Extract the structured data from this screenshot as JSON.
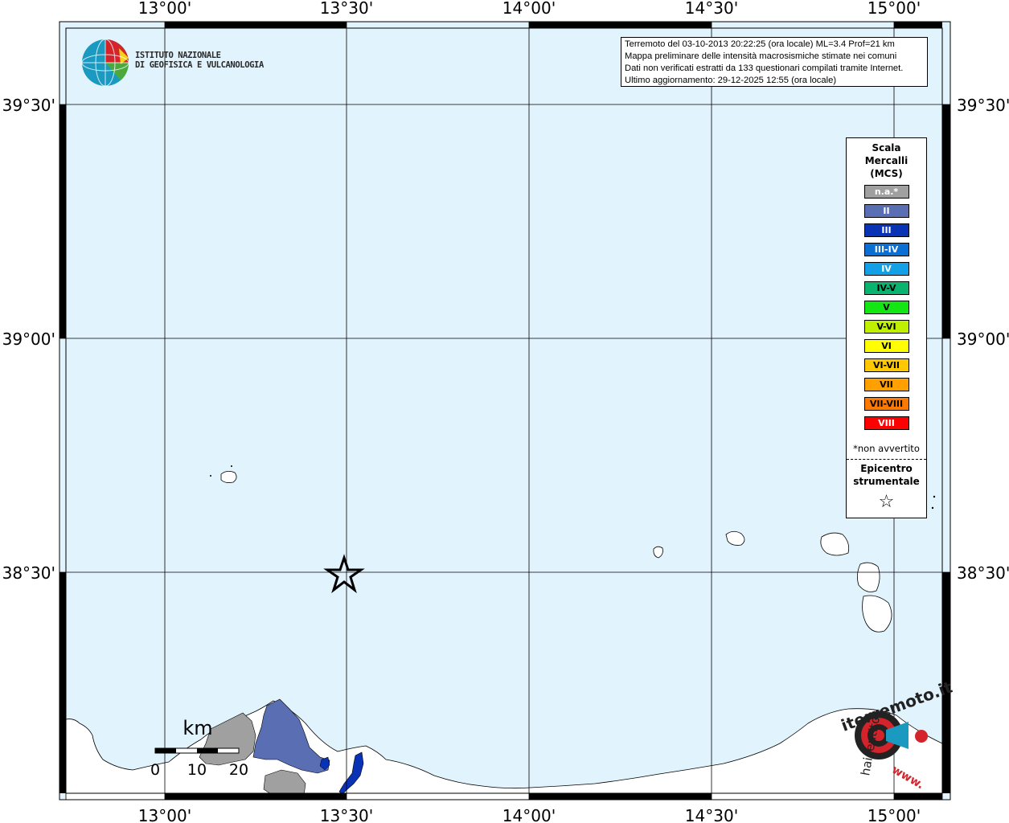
{
  "info": {
    "line1": "Terremoto del 03-10-2013 20:22:25 (ora locale) ML=3.4 Prof=21 km",
    "line2": "Mappa preliminare delle intensità macrosismiche stimate nei comuni",
    "line3": "Dati non verificati estratti da 133 questionari compilati tramite Internet.",
    "line4": "Ultimo aggiornamento: 29-12-2025 12:55 (ora locale)"
  },
  "logo": {
    "line1": "ISTITUTO NAZIONALE",
    "line2": "DI GEOFISICA E VULCANOLOGIA"
  },
  "axes": {
    "lon_labels": [
      "13°00'",
      "13°30'",
      "14°00'",
      "14°30'",
      "15°00'"
    ],
    "lat_labels": [
      "39°30'",
      "39°00'",
      "38°30'"
    ]
  },
  "scale_bar": {
    "unit": "km",
    "labels": [
      "0",
      "10",
      "20"
    ]
  },
  "legend": {
    "title_line1": "Scala",
    "title_line2": "Mercalli",
    "title_line3": "(MCS)",
    "items": [
      {
        "label": "n.a.*",
        "color": "#a0a0a0",
        "text_color": "#ffffff"
      },
      {
        "label": "II",
        "color": "#5a6eb4",
        "text_color": "#ffffff"
      },
      {
        "label": "III",
        "color": "#0a32b4",
        "text_color": "#ffffff"
      },
      {
        "label": "III-IV",
        "color": "#0a6ed2",
        "text_color": "#ffffff"
      },
      {
        "label": "IV",
        "color": "#14a0e6",
        "text_color": "#ffffff"
      },
      {
        "label": "IV-V",
        "color": "#0ab46e",
        "text_color": "#000000"
      },
      {
        "label": "V",
        "color": "#14e614",
        "text_color": "#000000"
      },
      {
        "label": "V-VI",
        "color": "#bef000",
        "text_color": "#000000"
      },
      {
        "label": "VI",
        "color": "#ffff00",
        "text_color": "#000000"
      },
      {
        "label": "VI-VII",
        "color": "#ffc800",
        "text_color": "#000000"
      },
      {
        "label": "VII",
        "color": "#ffa000",
        "text_color": "#000000"
      },
      {
        "label": "VII-VIII",
        "color": "#ff7800",
        "text_color": "#000000"
      },
      {
        "label": "VIII",
        "color": "#ff0000",
        "text_color": "#ffffff"
      }
    ],
    "note": "*non avvertito",
    "epicenter_line1": "Epicentro",
    "epicenter_line2": "strumentale",
    "epicenter_symbol": "☆"
  },
  "watermark": {
    "text_top": "iterremoto.it",
    "text_left": "haisentito",
    "text_bottom": "www."
  },
  "colors": {
    "sea": "#e1f3fd",
    "land": "#ffffff",
    "intensity_na": "#a0a0a0",
    "intensity_II": "#5a6eb4",
    "intensity_III": "#0a32b4"
  }
}
